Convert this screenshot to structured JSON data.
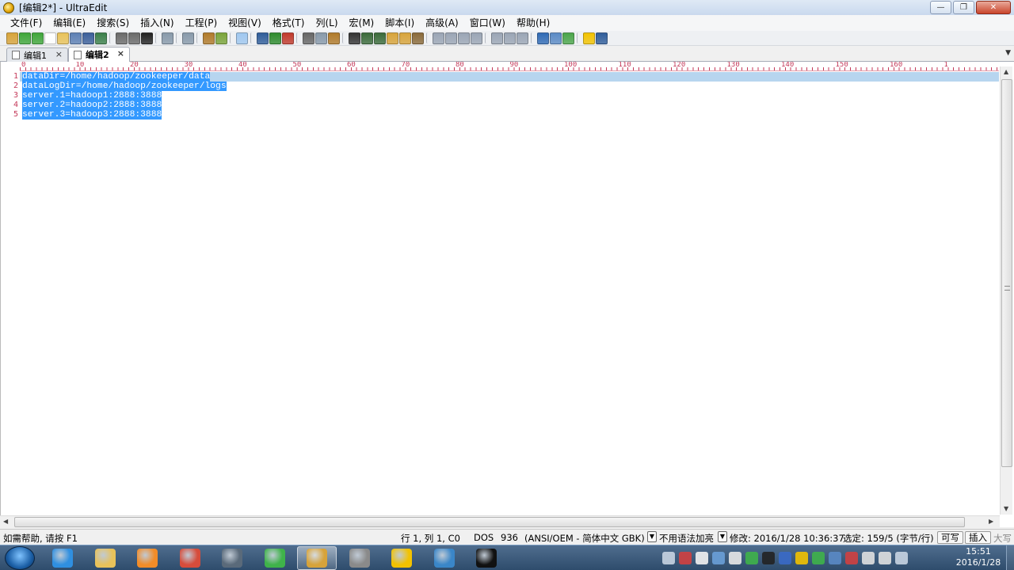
{
  "window": {
    "title": "[编辑2*] - UltraEdit",
    "minimize_glyph": "—",
    "maximize_glyph": "❐",
    "close_glyph": "✕"
  },
  "menu": [
    {
      "label": "文件(F)"
    },
    {
      "label": "编辑(E)"
    },
    {
      "label": "搜索(S)"
    },
    {
      "label": "插入(N)"
    },
    {
      "label": "工程(P)"
    },
    {
      "label": "视图(V)"
    },
    {
      "label": "格式(T)"
    },
    {
      "label": "列(L)"
    },
    {
      "label": "宏(M)"
    },
    {
      "label": "脚本(I)"
    },
    {
      "label": "高级(A)"
    },
    {
      "label": "窗口(W)"
    },
    {
      "label": "帮助(H)"
    }
  ],
  "toolbar_icons": [
    {
      "name": "new-project-icon",
      "color": "#d7a33a"
    },
    {
      "name": "back-icon",
      "color": "#3fa63a"
    },
    {
      "name": "forward-icon",
      "color": "#3fa63a"
    },
    {
      "name": "new-file-icon",
      "color": "#ffffff"
    },
    {
      "name": "open-file-icon",
      "color": "#e8c25a"
    },
    {
      "name": "close-file-icon",
      "color": "#5c7fb4"
    },
    {
      "name": "save-icon",
      "color": "#3b5f9a"
    },
    {
      "name": "save-all-icon",
      "color": "#3b7f4a"
    },
    {
      "name": "sep"
    },
    {
      "name": "print-icon",
      "color": "#6a6a6a"
    },
    {
      "name": "print-preview-icon",
      "color": "#6a6a6a"
    },
    {
      "name": "font-icon",
      "color": "#222222"
    },
    {
      "name": "sep"
    },
    {
      "name": "word-wrap-icon",
      "color": "#8899aa"
    },
    {
      "name": "sep"
    },
    {
      "name": "column-mode-icon",
      "color": "#8899aa"
    },
    {
      "name": "sep"
    },
    {
      "name": "hex-mode-icon",
      "color": "#b07a2a"
    },
    {
      "name": "function-list-icon",
      "color": "#7aa43a"
    },
    {
      "name": "sep"
    },
    {
      "name": "line-numbers-icon",
      "color": "#9fc7ef"
    },
    {
      "name": "sep"
    },
    {
      "name": "nav-back-icon",
      "color": "#2f5d9a"
    },
    {
      "name": "nav-forward-icon",
      "color": "#2d8a2d"
    },
    {
      "name": "stop-icon",
      "color": "#c0392b"
    },
    {
      "name": "sep"
    },
    {
      "name": "cut-icon",
      "color": "#666666"
    },
    {
      "name": "copy-icon",
      "color": "#8899aa"
    },
    {
      "name": "paste-icon",
      "color": "#b07a2a"
    },
    {
      "name": "sep"
    },
    {
      "name": "find-icon",
      "color": "#333333"
    },
    {
      "name": "find-next-icon",
      "color": "#3a6a3a"
    },
    {
      "name": "replace-icon",
      "color": "#3a6a3a"
    },
    {
      "name": "find-in-files-icon",
      "color": "#d7a33a"
    },
    {
      "name": "replace-in-files-icon",
      "color": "#d7a33a"
    },
    {
      "name": "goto-icon",
      "color": "#8a6a3a"
    },
    {
      "name": "sep"
    },
    {
      "name": "align-left-icon",
      "color": "#9aa5b5"
    },
    {
      "name": "align-center-icon",
      "color": "#9aa5b5"
    },
    {
      "name": "align-right-icon",
      "color": "#9aa5b5"
    },
    {
      "name": "justify-icon",
      "color": "#9aa5b5"
    },
    {
      "name": "sep"
    },
    {
      "name": "split-horizontal-icon",
      "color": "#9aa5b5"
    },
    {
      "name": "split-vertical-icon",
      "color": "#9aa5b5"
    },
    {
      "name": "cascade-icon",
      "color": "#9aa5b5"
    },
    {
      "name": "sep"
    },
    {
      "name": "web-browser-icon",
      "color": "#2f6ab5"
    },
    {
      "name": "ftp-icon",
      "color": "#5a8ac5"
    },
    {
      "name": "refresh-icon",
      "color": "#4aa54a"
    },
    {
      "name": "sep"
    },
    {
      "name": "tip-icon",
      "color": "#f2c200"
    },
    {
      "name": "help-icon",
      "color": "#2f5d9a"
    }
  ],
  "tabs": [
    {
      "label": "编辑1",
      "close": "×",
      "active": false
    },
    {
      "label": "编辑2",
      "close": "×",
      "active": true
    }
  ],
  "tab_dropdown_glyph": "▼",
  "ruler": {
    "labels": [
      "0",
      "10",
      "20",
      "30",
      "40",
      "50",
      "60",
      "70",
      "80",
      "90",
      "100",
      "110",
      "120",
      "130",
      "140",
      "150",
      "160",
      "1"
    ]
  },
  "editor": {
    "lines": [
      {
        "number": "1",
        "text": "dataDir=/home/hadoop/zookeeper/data"
      },
      {
        "number": "2",
        "text": "dataLogDir=/home/hadoop/zookeeper/logs"
      },
      {
        "number": "3",
        "text": "server.1=hadoop1:2888:3888"
      },
      {
        "number": "4",
        "text": "server.2=hadoop2:2888:3888"
      },
      {
        "number": "5",
        "text": "server.3=hadoop3:2888:3888"
      }
    ]
  },
  "scroll": {
    "up": "▲",
    "down": "▼",
    "left": "◀",
    "right": "▶"
  },
  "status": {
    "help": "如需帮助, 请按 F1",
    "position": "行 1, 列 1, C0",
    "line_ending": "DOS",
    "codepage": "936",
    "encoding": "(ANSI/OEM - 简体中文 GBK)",
    "syntax": "不用语法加亮",
    "modified": "修改: 2016/1/28 10:36:37",
    "selection": "选定: 159/5 (字节/行)",
    "writable": "可写",
    "insert": "插入",
    "caps": "大写",
    "dropdown_glyph": "▼"
  },
  "taskbar": {
    "apps": [
      {
        "name": "ie-icon",
        "color": "#2f8fe0",
        "active": false
      },
      {
        "name": "explorer-icon",
        "color": "#e8c25a",
        "active": false
      },
      {
        "name": "media-player-icon",
        "color": "#f28c28",
        "active": false
      },
      {
        "name": "chrome-icon",
        "color": "#d64c3b",
        "active": false
      },
      {
        "name": "network-app-icon",
        "color": "#5a6a7a",
        "active": false
      },
      {
        "name": "ie-green-icon",
        "color": "#3fb34a",
        "active": false
      },
      {
        "name": "ultraedit-icon",
        "color": "#d7a33a",
        "active": true
      },
      {
        "name": "printer-app-icon",
        "color": "#8a8a8a",
        "active": false
      },
      {
        "name": "music-app-icon",
        "color": "#f2c200",
        "active": false
      },
      {
        "name": "virtualbox-icon",
        "color": "#3a86c8",
        "active": false
      },
      {
        "name": "terminal-icon",
        "color": "#111111",
        "active": false
      }
    ],
    "tray": [
      {
        "name": "keyboard-tray-icon",
        "color": "#c8d4e2"
      },
      {
        "name": "network-tray-icon",
        "color": "#d04040"
      },
      {
        "name": "clipboard-tray-icon",
        "color": "#f2f2f2"
      },
      {
        "name": "shield-tray-icon",
        "color": "#6aa0d8"
      },
      {
        "name": "windows-tray-icon",
        "color": "#e8e8e8"
      },
      {
        "name": "360-tray-icon",
        "color": "#3fb34a"
      },
      {
        "name": "qq-tray-icon",
        "color": "#222222"
      },
      {
        "name": "bluetooth-tray-icon",
        "color": "#3a6ac8"
      },
      {
        "name": "plus-tray-icon",
        "color": "#f2c200"
      },
      {
        "name": "security-tray-icon",
        "color": "#3fb34a"
      },
      {
        "name": "monitor-tray-icon",
        "color": "#5a8ac5"
      },
      {
        "name": "flag-tray-icon",
        "color": "#d04040"
      },
      {
        "name": "usb-tray-icon",
        "color": "#e0e0e0"
      },
      {
        "name": "volume-tray-icon",
        "color": "#e0e0e0"
      },
      {
        "name": "signal-tray-icon",
        "color": "#c8d4e2"
      }
    ],
    "time": "15:51",
    "date": "2016/1/28"
  }
}
